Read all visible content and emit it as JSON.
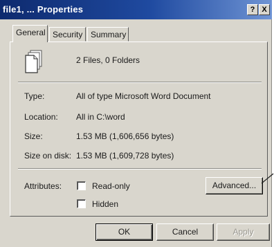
{
  "window": {
    "title": "file1, ... Properties",
    "help_button": "?",
    "close_button": "X"
  },
  "tabs": [
    {
      "label": "General",
      "active": true
    },
    {
      "label": "Security",
      "active": false
    },
    {
      "label": "Summary",
      "active": false
    }
  ],
  "general": {
    "icon": "document-stack-icon",
    "summary": "2 Files, 0 Folders",
    "properties": [
      {
        "label": "Type:",
        "value": "All of type Microsoft Word Document"
      },
      {
        "label": "Location:",
        "value": "All in C:\\word"
      },
      {
        "label": "Size:",
        "value": "1.53 MB (1,606,656 bytes)"
      },
      {
        "label": "Size on disk:",
        "value": "1.53 MB (1,609,728 bytes)"
      }
    ],
    "attributes": {
      "label": "Attributes:",
      "read_only": {
        "label": "Read-only",
        "checked": false
      },
      "hidden": {
        "label": "Hidden",
        "checked": false
      },
      "advanced_button": "Advanced..."
    }
  },
  "buttons": {
    "ok": "OK",
    "cancel": "Cancel",
    "apply": "Apply"
  },
  "colors": {
    "titlebar_start": "#0e2a6e",
    "titlebar_end": "#6f94d4",
    "face": "#d9d6cd"
  }
}
